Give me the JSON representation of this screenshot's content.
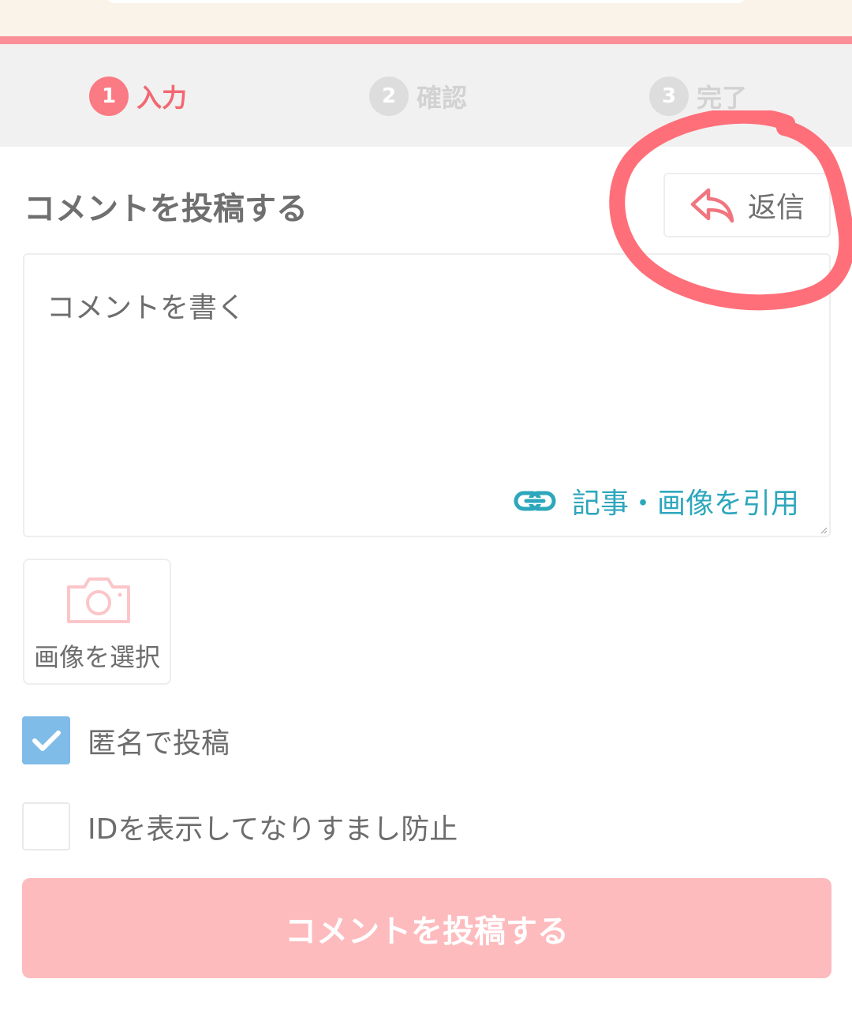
{
  "steps": [
    {
      "num": "1",
      "label": "入力",
      "state": "active"
    },
    {
      "num": "2",
      "label": "確認",
      "state": "inactive"
    },
    {
      "num": "3",
      "label": "完了",
      "state": "inactive"
    }
  ],
  "form": {
    "heading": "コメントを投稿する",
    "reply_label": "返信",
    "comment_placeholder": "コメントを書く",
    "comment_value": "",
    "quote_label": "記事・画像を引用",
    "image_select_label": "画像を選択",
    "anonymous_label": "匿名で投稿",
    "anonymous_checked": true,
    "show_id_label": "IDを表示してなりすまし防止",
    "show_id_checked": false,
    "submit_label": "コメントを投稿する"
  },
  "colors": {
    "accent": "#fa7b83",
    "link": "#2ea7bd",
    "checkbox_on": "#7fbce8",
    "submit_disabled": "#fdbbbe",
    "annotation": "#ff6f79"
  },
  "icons": {
    "reply": "reply-arrow-icon",
    "quote": "link-chain-icon",
    "image": "camera-icon",
    "check": "checkmark-icon"
  }
}
